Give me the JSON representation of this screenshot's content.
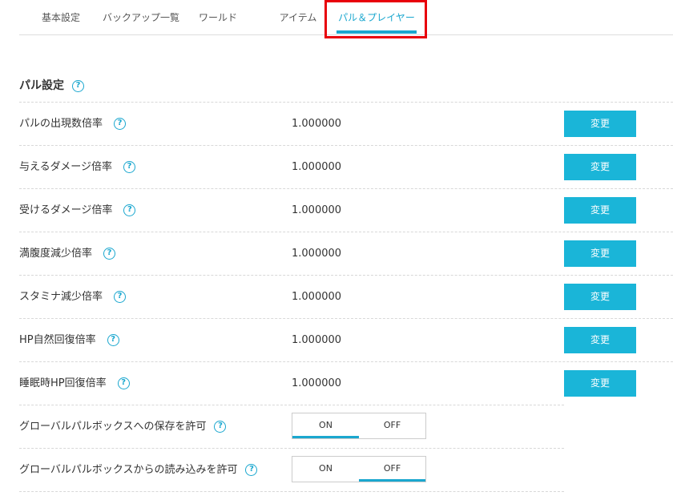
{
  "tabs": [
    {
      "label": "基本設定"
    },
    {
      "label": "バックアップ一覧"
    },
    {
      "label": "ワールド"
    },
    {
      "label": "アイテム"
    },
    {
      "label": "パル＆プレイヤー",
      "active": true
    }
  ],
  "section": {
    "title": "パル設定",
    "help_glyph": "?"
  },
  "settings": [
    {
      "label": "パルの出現数倍率",
      "value": "1.000000",
      "button": "変更"
    },
    {
      "label": "与えるダメージ倍率",
      "value": "1.000000",
      "button": "変更"
    },
    {
      "label": "受けるダメージ倍率",
      "value": "1.000000",
      "button": "変更"
    },
    {
      "label": "満腹度減少倍率",
      "value": "1.000000",
      "button": "変更"
    },
    {
      "label": "スタミナ減少倍率",
      "value": "1.000000",
      "button": "変更"
    },
    {
      "label": "HP自然回復倍率",
      "value": "1.000000",
      "button": "変更"
    },
    {
      "label": "睡眠時HP回復倍率",
      "value": "1.000000",
      "button": "変更"
    }
  ],
  "toggles": [
    {
      "label": "グローバルパルボックスへの保存を許可",
      "on": "ON",
      "off": "OFF",
      "selected": "ON"
    },
    {
      "label": "グローバルパルボックスからの読み込みを許可",
      "on": "ON",
      "off": "OFF",
      "selected": "OFF"
    }
  ],
  "colors": {
    "accent": "#1aa7cf",
    "button": "#1ab5d8",
    "highlight": "#e8000a"
  }
}
